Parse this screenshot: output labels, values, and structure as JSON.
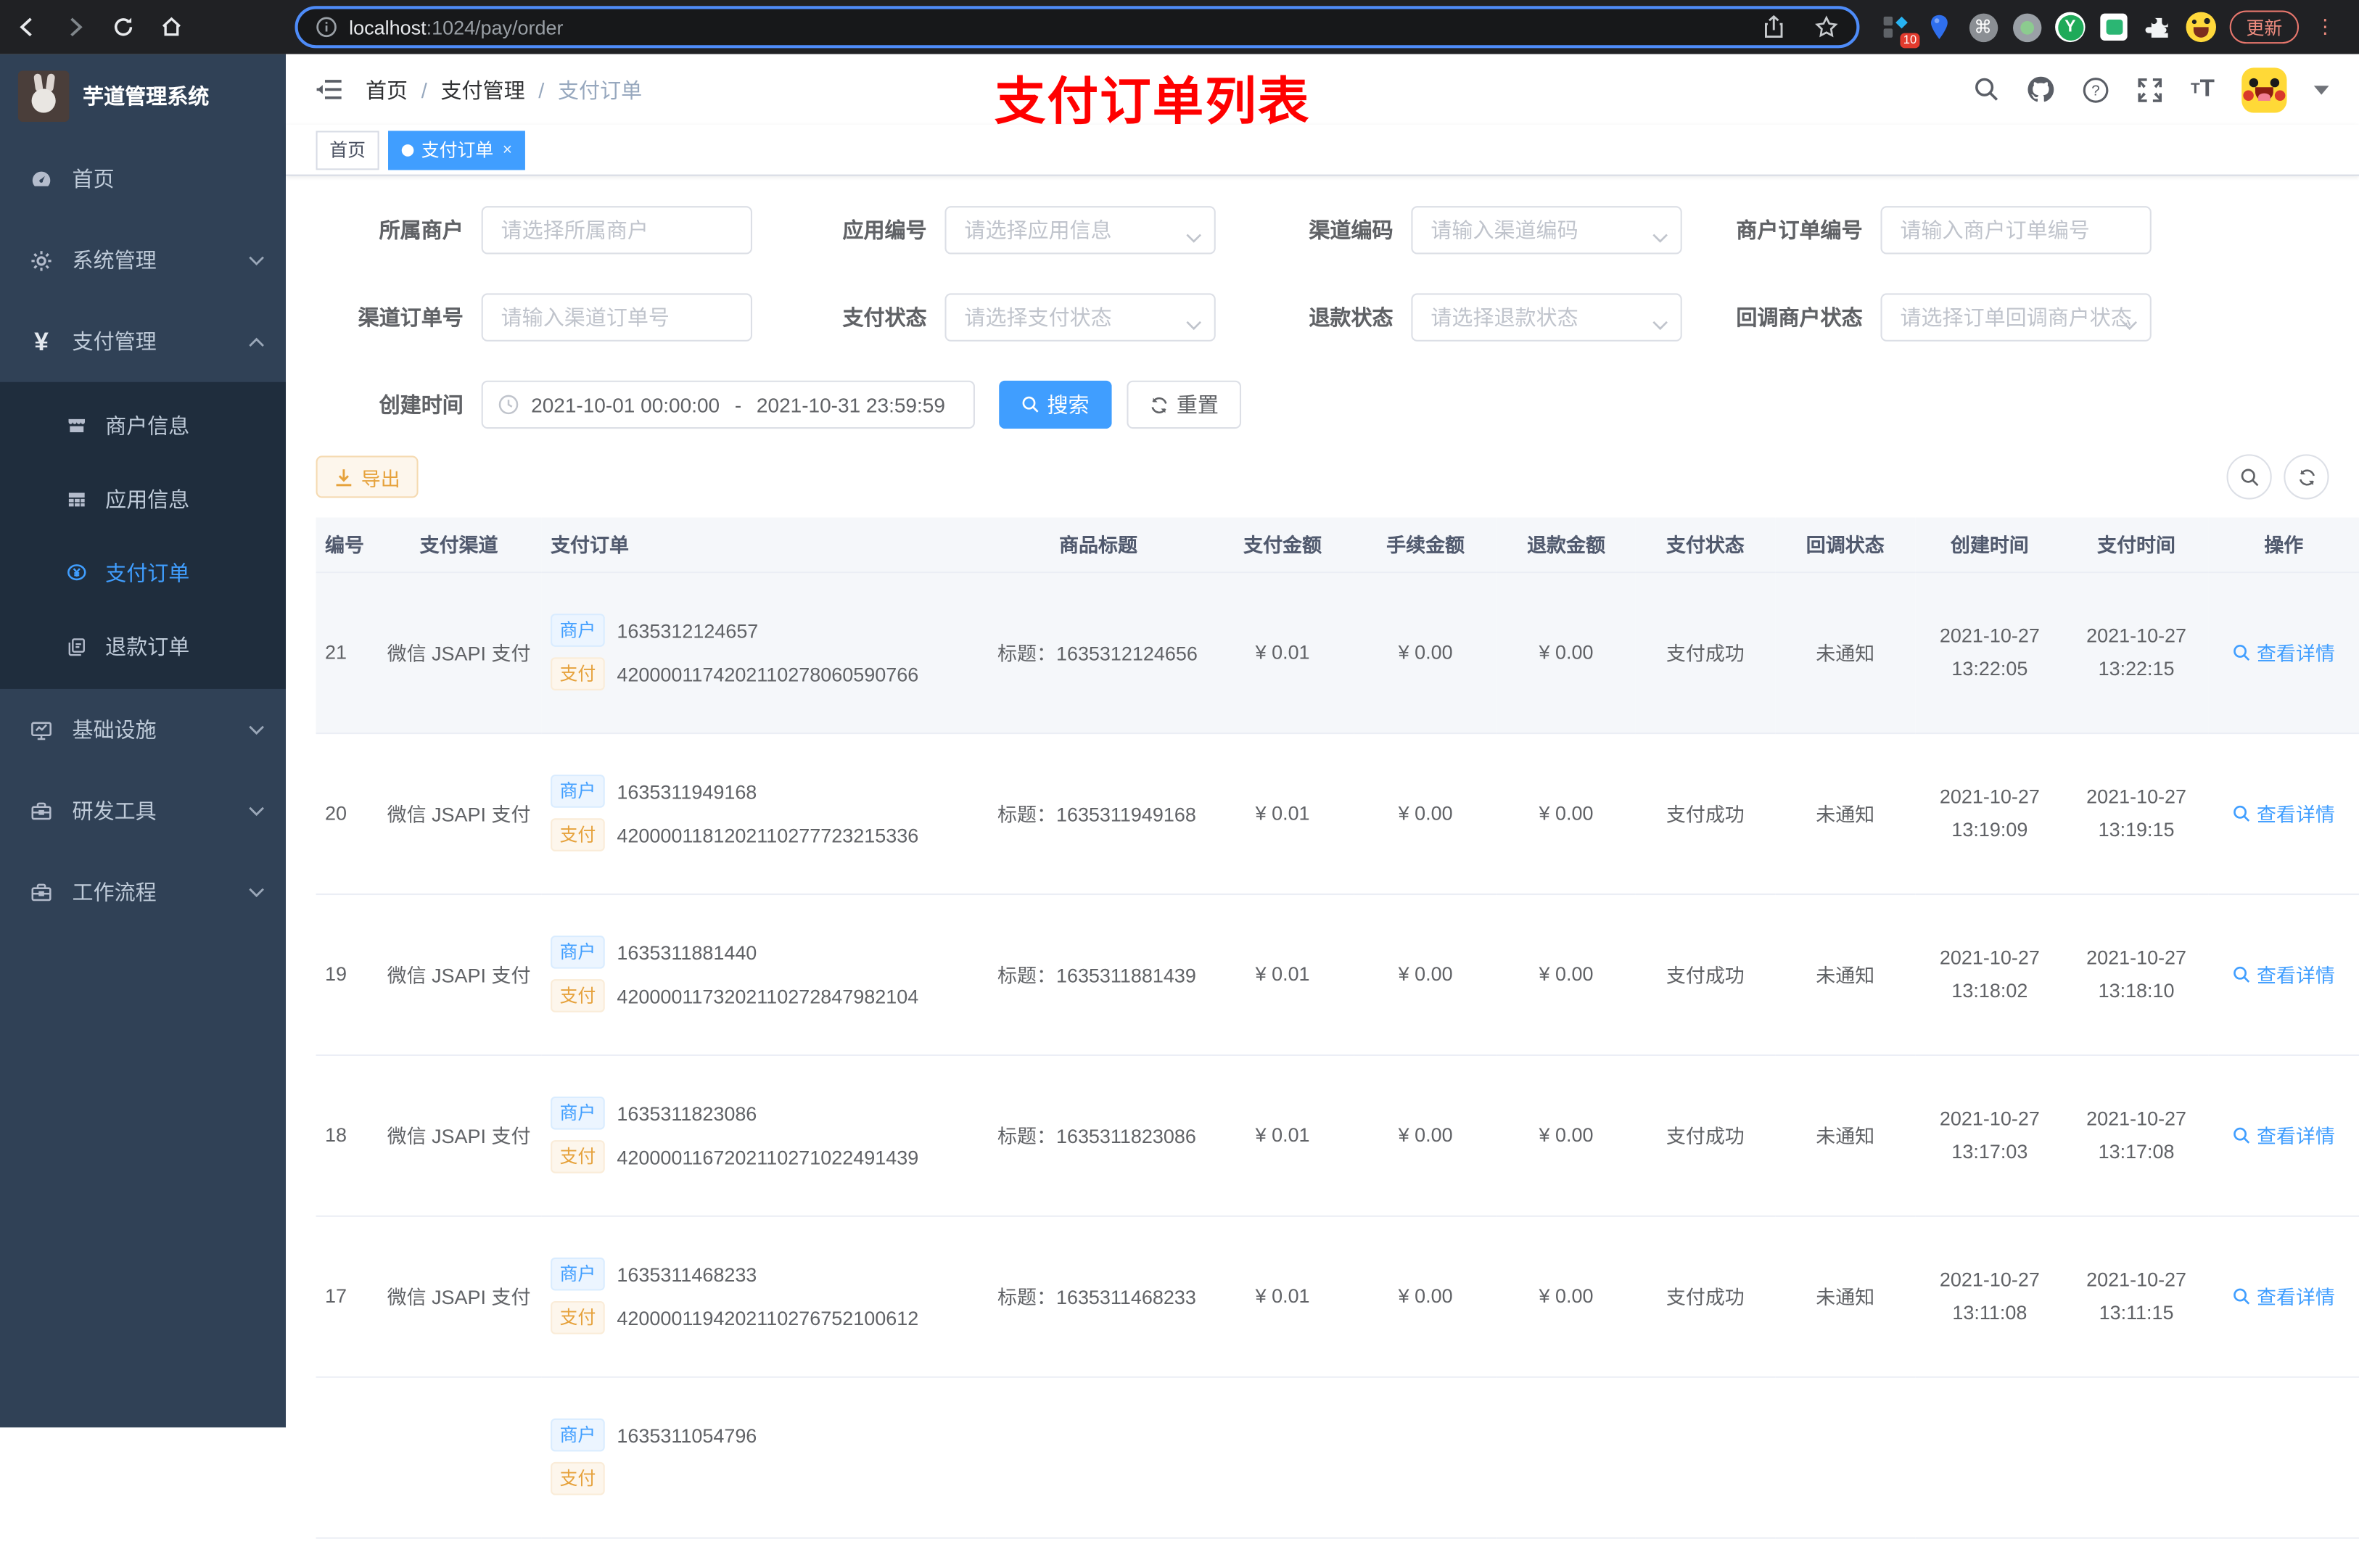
{
  "browser": {
    "url_host": "localhost",
    "url_path": ":1024/pay/order",
    "extension_badge": "10",
    "update_label": "更新"
  },
  "sidebar": {
    "title": "芋道管理系统",
    "menu": [
      {
        "label": "首页",
        "icon": "dashboard-icon",
        "type": "item"
      },
      {
        "label": "系统管理",
        "icon": "gear-icon",
        "type": "group",
        "state": "collapsed"
      },
      {
        "label": "支付管理",
        "icon": "yen-icon",
        "type": "group",
        "state": "expanded",
        "children": [
          {
            "label": "商户信息",
            "icon": "shop-icon",
            "active": false
          },
          {
            "label": "应用信息",
            "icon": "grid-icon",
            "active": false
          },
          {
            "label": "支付订单",
            "icon": "pay-order-icon",
            "active": true
          },
          {
            "label": "退款订单",
            "icon": "refund-icon",
            "active": false
          }
        ]
      },
      {
        "label": "基础设施",
        "icon": "monitor-icon",
        "type": "group",
        "state": "collapsed"
      },
      {
        "label": "研发工具",
        "icon": "toolbox-icon",
        "type": "group",
        "state": "collapsed"
      },
      {
        "label": "工作流程",
        "icon": "toolbox-icon",
        "type": "group",
        "state": "collapsed"
      }
    ]
  },
  "navbar": {
    "breadcrumb": [
      "首页",
      "支付管理",
      "支付订单"
    ],
    "separator": "/",
    "annotation": "支付订单列表"
  },
  "tags": [
    {
      "label": "首页",
      "active": false
    },
    {
      "label": "支付订单",
      "active": true
    }
  ],
  "filters": {
    "fields": [
      {
        "label": "所属商户",
        "placeholder": "请选择所属商户",
        "arrow": false
      },
      {
        "label": "应用编号",
        "placeholder": "请选择应用信息",
        "arrow": true
      },
      {
        "label": "渠道编码",
        "placeholder": "请输入渠道编码",
        "arrow": true
      },
      {
        "label": "商户订单编号",
        "placeholder": "请输入商户订单编号",
        "arrow": false
      },
      {
        "label": "渠道订单号",
        "placeholder": "请输入渠道订单号",
        "arrow": false
      },
      {
        "label": "支付状态",
        "placeholder": "请选择支付状态",
        "arrow": true
      },
      {
        "label": "退款状态",
        "placeholder": "请选择退款状态",
        "arrow": true
      },
      {
        "label": "回调商户状态",
        "placeholder": "请选择订单回调商户状态",
        "arrow": true
      }
    ],
    "date": {
      "label": "创建时间",
      "start": "2021-10-01 00:00:00",
      "separator": "-",
      "end": "2021-10-31 23:59:59"
    },
    "search_label": "搜索",
    "reset_label": "重置"
  },
  "toolbar": {
    "export_label": "导出"
  },
  "table": {
    "columns": [
      "编号",
      "支付渠道",
      "支付订单",
      "商品标题",
      "支付金额",
      "手续金额",
      "退款金额",
      "支付状态",
      "回调状态",
      "创建时间",
      "支付时间",
      "操作"
    ],
    "badge_merchant": "商户",
    "badge_pay": "支付",
    "action_label": "查看详情",
    "rows": [
      {
        "id": "21",
        "channel": "微信 JSAPI 支付",
        "merchant_no": "1635312124657",
        "pay_no": "4200001174202110278060590766",
        "title": "标题：1635312124656",
        "amount": "¥ 0.01",
        "fee": "¥ 0.00",
        "refund": "¥ 0.00",
        "pay_status": "支付成功",
        "notify_status": "未通知",
        "create_time": "2021-10-27 13:22:05",
        "pay_time": "2021-10-27 13:22:15"
      },
      {
        "id": "20",
        "channel": "微信 JSAPI 支付",
        "merchant_no": "1635311949168",
        "pay_no": "4200001181202110277723215336",
        "title": "标题：1635311949168",
        "amount": "¥ 0.01",
        "fee": "¥ 0.00",
        "refund": "¥ 0.00",
        "pay_status": "支付成功",
        "notify_status": "未通知",
        "create_time": "2021-10-27 13:19:09",
        "pay_time": "2021-10-27 13:19:15"
      },
      {
        "id": "19",
        "channel": "微信 JSAPI 支付",
        "merchant_no": "1635311881440",
        "pay_no": "4200001173202110272847982104",
        "title": "标题：1635311881439",
        "amount": "¥ 0.01",
        "fee": "¥ 0.00",
        "refund": "¥ 0.00",
        "pay_status": "支付成功",
        "notify_status": "未通知",
        "create_time": "2021-10-27 13:18:02",
        "pay_time": "2021-10-27 13:18:10"
      },
      {
        "id": "18",
        "channel": "微信 JSAPI 支付",
        "merchant_no": "1635311823086",
        "pay_no": "4200001167202110271022491439",
        "title": "标题：1635311823086",
        "amount": "¥ 0.01",
        "fee": "¥ 0.00",
        "refund": "¥ 0.00",
        "pay_status": "支付成功",
        "notify_status": "未通知",
        "create_time": "2021-10-27 13:17:03",
        "pay_time": "2021-10-27 13:17:08"
      },
      {
        "id": "17",
        "channel": "微信 JSAPI 支付",
        "merchant_no": "1635311468233",
        "pay_no": "4200001194202110276752100612",
        "title": "标题：1635311468233",
        "amount": "¥ 0.01",
        "fee": "¥ 0.00",
        "refund": "¥ 0.00",
        "pay_status": "支付成功",
        "notify_status": "未通知",
        "create_time": "2021-10-27 13:11:08",
        "pay_time": "2021-10-27 13:11:15"
      }
    ],
    "partial_row": {
      "merchant_no": "1635311054796"
    }
  },
  "colors": {
    "primary": "#409eff",
    "warning": "#e6a23c",
    "annotation": "#ff0000",
    "sidebar_bg": "#304156",
    "submenu_bg": "#1f2d3d"
  }
}
